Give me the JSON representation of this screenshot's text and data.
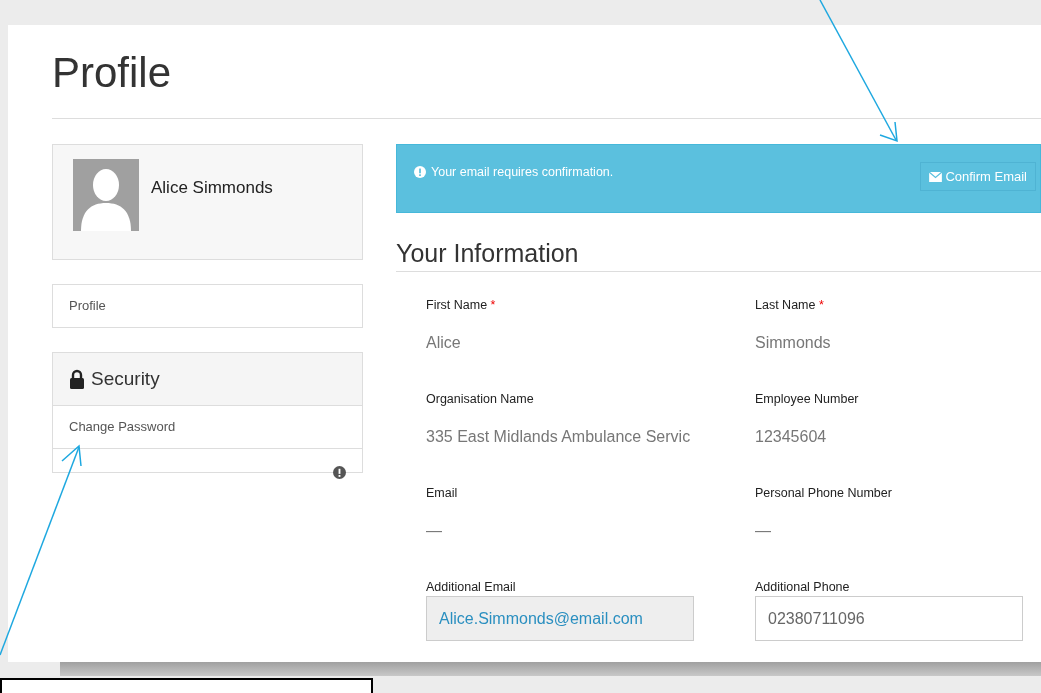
{
  "page": {
    "title": "Profile"
  },
  "user_card": {
    "name": "Alice Simmonds"
  },
  "nav": [
    {
      "label": "Profile"
    }
  ],
  "security": {
    "title": "Security",
    "items": [
      {
        "label": "Change Password"
      }
    ]
  },
  "alert": {
    "message": "Your email requires confirmation.",
    "button": "Confirm Email"
  },
  "section": {
    "title": "Your Information"
  },
  "fields": [
    {
      "kind": "text",
      "label": "First Name",
      "required_mark": "*",
      "value": "Alice"
    },
    {
      "kind": "text",
      "label": "Last Name",
      "required_mark": "*",
      "value": "Simmonds"
    },
    {
      "kind": "text",
      "label": "Organisation Name",
      "value": "335 East Midlands Ambulance Servic"
    },
    {
      "kind": "text",
      "label": "Employee Number",
      "value": "12345604"
    },
    {
      "kind": "text",
      "label": "Email",
      "value": "—"
    },
    {
      "kind": "text",
      "label": "Personal Phone Number",
      "value": "—"
    },
    {
      "kind": "input",
      "label": "Additional Email",
      "value": "Alice.Simmonds@email.com",
      "disabled": true
    },
    {
      "kind": "input",
      "label": "Additional Phone",
      "value": "02380711096",
      "disabled": false
    }
  ]
}
